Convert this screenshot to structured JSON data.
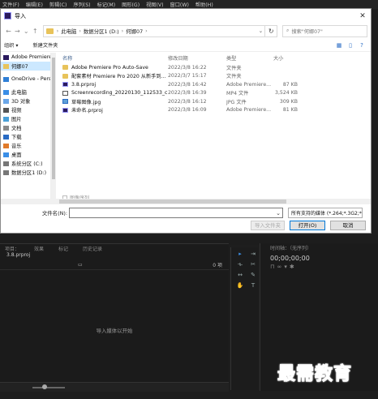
{
  "premiere": {
    "menus": [
      "文件(F)",
      "编辑(E)",
      "剪辑(C)",
      "序列(S)",
      "标记(M)",
      "图形(G)",
      "视图(V)",
      "窗口(W)",
      "帮助(H)"
    ],
    "panel_tabs": [
      "项目：",
      "效果",
      "标记",
      "历史记录"
    ],
    "project_name": "3.8.prproj",
    "item_count": "0 项",
    "import_hint": "导入媒体以开始",
    "timeline_tab": "时间轴：（无序列）",
    "timecode": "00;00;00;00"
  },
  "dialog": {
    "title": "导入",
    "breadcrumb": [
      "此电脑",
      "数据分区1 (D:)",
      "何娜07"
    ],
    "search_placeholder": "搜索\"何娜07\"",
    "toolbar": {
      "organize": "组织 ▾",
      "new_folder": "新建文件夹"
    },
    "nav_items": [
      {
        "label": "Adobe Premiere",
        "icon": "premiere-icon"
      },
      {
        "label": "何娜07",
        "icon": "folder-icon",
        "selected": true
      },
      {
        "label": "OneDrive - Perso",
        "icon": "onedrive-icon"
      },
      {
        "label": "此电脑",
        "icon": "computer-icon"
      },
      {
        "label": "3D 对象",
        "icon": "3d-objects-icon"
      },
      {
        "label": "视频",
        "icon": "video-icon"
      },
      {
        "label": "图片",
        "icon": "pictures-icon"
      },
      {
        "label": "文档",
        "icon": "documents-icon"
      },
      {
        "label": "下载",
        "icon": "download-icon"
      },
      {
        "label": "音乐",
        "icon": "music-icon"
      },
      {
        "label": "桌面",
        "icon": "desktop-icon"
      },
      {
        "label": "系统分区 (C:)",
        "icon": "drive-icon"
      },
      {
        "label": "数据分区1 (D:)",
        "icon": "drive-icon"
      }
    ],
    "columns": {
      "name": "名称",
      "date": "修改日期",
      "type": "类型",
      "size": "大小"
    },
    "files": [
      {
        "name": "Adobe Premiere Pro Auto-Save",
        "date": "2022/3/8 16:22",
        "type": "文件夹",
        "size": "",
        "icon": "folder"
      },
      {
        "name": "配套素材 Premiere Pro 2020 从新手到...",
        "date": "2022/3/7 15:17",
        "type": "文件夹",
        "size": "",
        "icon": "folder"
      },
      {
        "name": "3.8.prproj",
        "date": "2022/3/8 16:42",
        "type": "Adobe Premiere...",
        "size": "87 KB",
        "icon": "pr"
      },
      {
        "name": "Screenrecording_20220130_112533_c...",
        "date": "2022/3/8 16:39",
        "type": "MP4 文件",
        "size": "3,524 KB",
        "icon": "mp4"
      },
      {
        "name": "草莓图像.jpg",
        "date": "2022/3/8 16:12",
        "type": "JPG 文件",
        "size": "309 KB",
        "icon": "jpg"
      },
      {
        "name": "未命名.prproj",
        "date": "2022/3/8 16:09",
        "type": "Adobe Premiere...",
        "size": "81 KB",
        "icon": "pr"
      }
    ],
    "image_sequence_label": "图像序列",
    "filename_label": "文件名(N):",
    "filename_value": "",
    "filter_value": "所有支持的媒体 (*.264;*.3G2;*",
    "import_folder_button": "导入文件夹",
    "open_button": "打开(O)",
    "cancel_button": "取消"
  },
  "watermark": "最需教育"
}
